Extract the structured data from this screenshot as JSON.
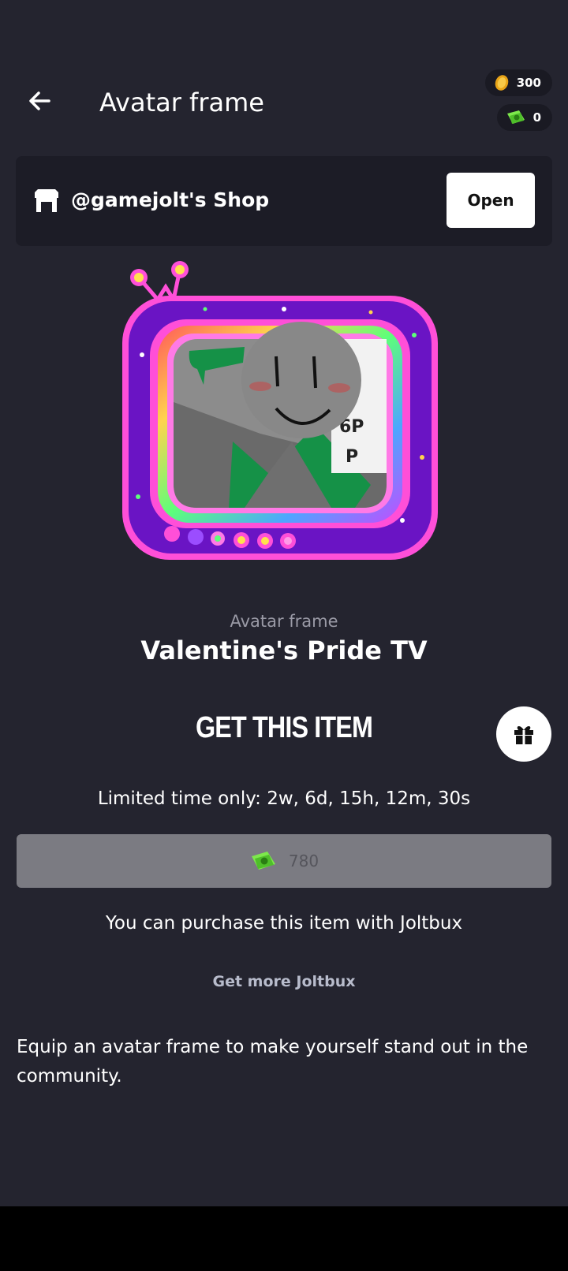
{
  "header": {
    "title": "Avatar frame",
    "coins": "300",
    "joltbux": "0"
  },
  "shop": {
    "name": "@gamejolt's Shop",
    "open_label": "Open"
  },
  "item": {
    "type": "Avatar frame",
    "name": "Valentine's Pride TV"
  },
  "purchase": {
    "heading": "GET THIS ITEM",
    "limited_time": "Limited time only: 2w, 6d, 15h, 12m, 30s",
    "price": "780",
    "note": "You can purchase this item with Joltbux",
    "get_more_label": "Get more Joltbux"
  },
  "description": "Equip an avatar frame to make yourself stand out in the community.",
  "icons": {
    "back": "arrow-left-icon",
    "coin": "coin-icon",
    "joltbux": "joltbux-icon",
    "shop": "shop-icon",
    "gift": "gift-icon"
  },
  "colors": {
    "background": "#24242f",
    "card": "#1c1c26",
    "button_disabled": "#7b7b82",
    "frame_purple": "#7a1fd1",
    "frame_pink": "#ff4fd8",
    "joltbux_green": "#7de84c"
  }
}
